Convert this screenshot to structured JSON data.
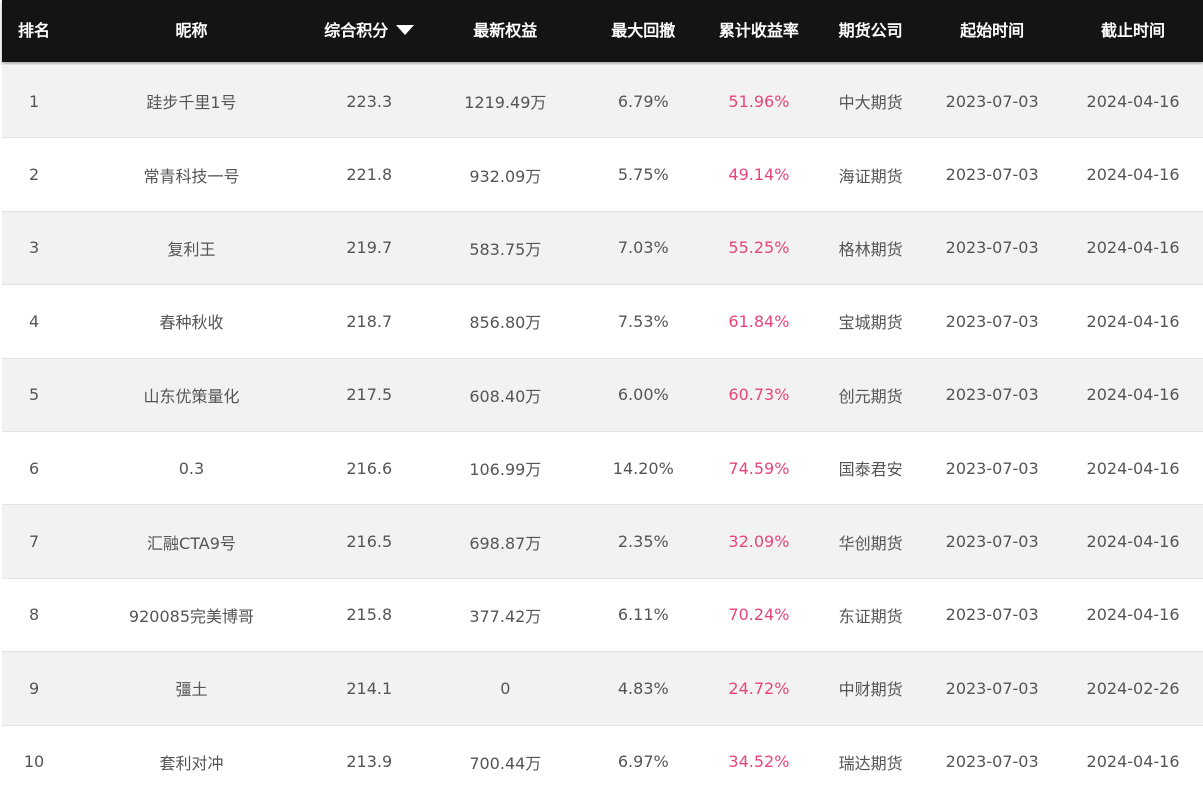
{
  "header": {
    "rank": "排名",
    "name": "昵称",
    "score": "综合积分",
    "equity": "最新权益",
    "max_drawdown": "最大回撤",
    "cum_return": "累计收益率",
    "futures_company": "期货公司",
    "start_time": "起始时间",
    "end_time": "截止时间",
    "sort_icon": "triangle-down-icon"
  },
  "colors": {
    "header_bg": "#141414",
    "header_text": "#ffffff",
    "row_odd": "#f2f2f2",
    "row_even": "#ffffff",
    "return_text": "#e8457a",
    "body_text": "#555555"
  },
  "rows": [
    {
      "rank": "1",
      "name": "跬步千里1号",
      "score": "223.3",
      "equity": "1219.49万",
      "max_drawdown": "6.79%",
      "cum_return": "51.96%",
      "company": "中大期货",
      "start": "2023-07-03",
      "end": "2024-04-16"
    },
    {
      "rank": "2",
      "name": "常青科技一号",
      "score": "221.8",
      "equity": "932.09万",
      "max_drawdown": "5.75%",
      "cum_return": "49.14%",
      "company": "海证期货",
      "start": "2023-07-03",
      "end": "2024-04-16"
    },
    {
      "rank": "3",
      "name": "复利王",
      "score": "219.7",
      "equity": "583.75万",
      "max_drawdown": "7.03%",
      "cum_return": "55.25%",
      "company": "格林期货",
      "start": "2023-07-03",
      "end": "2024-04-16"
    },
    {
      "rank": "4",
      "name": "春种秋收",
      "score": "218.7",
      "equity": "856.80万",
      "max_drawdown": "7.53%",
      "cum_return": "61.84%",
      "company": "宝城期货",
      "start": "2023-07-03",
      "end": "2024-04-16"
    },
    {
      "rank": "5",
      "name": "山东优策量化",
      "score": "217.5",
      "equity": "608.40万",
      "max_drawdown": "6.00%",
      "cum_return": "60.73%",
      "company": "创元期货",
      "start": "2023-07-03",
      "end": "2024-04-16"
    },
    {
      "rank": "6",
      "name": "0.3",
      "score": "216.6",
      "equity": "106.99万",
      "max_drawdown": "14.20%",
      "cum_return": "74.59%",
      "company": "国泰君安",
      "start": "2023-07-03",
      "end": "2024-04-16"
    },
    {
      "rank": "7",
      "name": "汇融CTA9号",
      "score": "216.5",
      "equity": "698.87万",
      "max_drawdown": "2.35%",
      "cum_return": "32.09%",
      "company": "华创期货",
      "start": "2023-07-03",
      "end": "2024-04-16"
    },
    {
      "rank": "8",
      "name": "920085完美博哥",
      "score": "215.8",
      "equity": "377.42万",
      "max_drawdown": "6.11%",
      "cum_return": "70.24%",
      "company": "东证期货",
      "start": "2023-07-03",
      "end": "2024-04-16"
    },
    {
      "rank": "9",
      "name": "彊土",
      "score": "214.1",
      "equity": "0",
      "max_drawdown": "4.83%",
      "cum_return": "24.72%",
      "company": "中财期货",
      "start": "2023-07-03",
      "end": "2024-02-26"
    },
    {
      "rank": "10",
      "name": "套利对冲",
      "score": "213.9",
      "equity": "700.44万",
      "max_drawdown": "6.97%",
      "cum_return": "34.52%",
      "company": "瑞达期货",
      "start": "2023-07-03",
      "end": "2024-04-16"
    }
  ]
}
